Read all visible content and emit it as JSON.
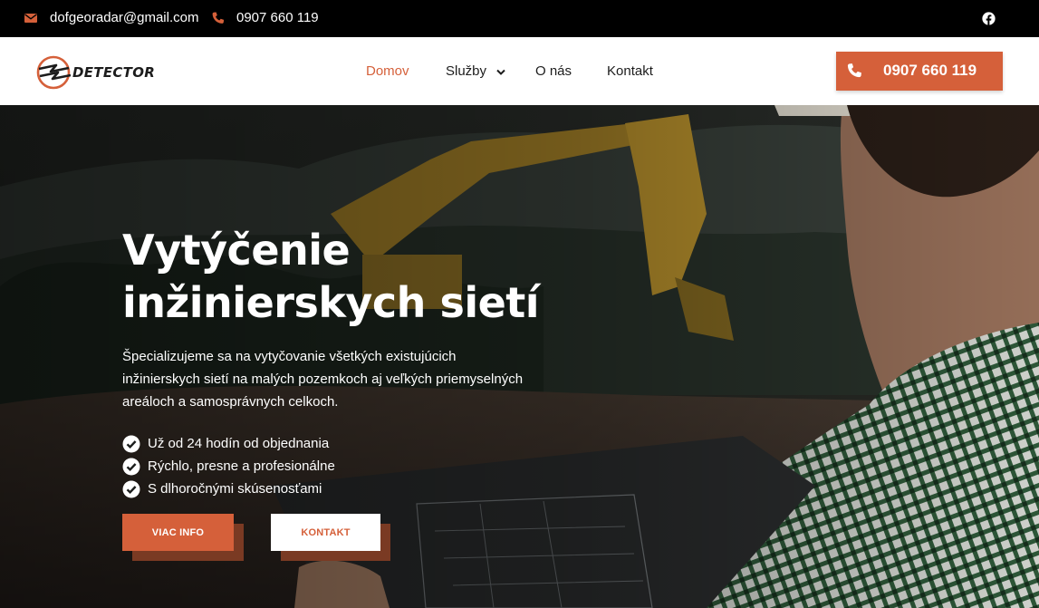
{
  "topbar": {
    "email": "dofgeoradar@gmail.com",
    "phone": "0907 660 119",
    "email_icon": "envelope-icon",
    "phone_icon": "phone-icon",
    "social_icon": "facebook-icon"
  },
  "header": {
    "logo_text": "DETECTOR",
    "nav": [
      {
        "label": "Domov",
        "active": true
      },
      {
        "label": "Služby",
        "has_dropdown": true
      },
      {
        "label": "O nás"
      },
      {
        "label": "Kontakt"
      }
    ],
    "cta_phone": "0907 660 119"
  },
  "hero": {
    "title_line1": "Vytýčenie",
    "title_line2": "inžinierskych sietí",
    "description": "Špecializujeme sa na vytyčovanie všetkých existujúcich inžinierskych sietí na malých pozemkoch aj veľkých priemyselných areáloch a samosprávnych celkoch.",
    "checks": [
      "Už od 24 hodín od objednania",
      "Rýchlo, presne a profesionálne",
      "S dlhoročnými skúsenosťami"
    ],
    "button_primary": "VIAC INFO",
    "button_secondary": "KONTAKT"
  },
  "colors": {
    "accent": "#d5603a",
    "topbar_bg": "#000000",
    "header_bg": "#ffffff",
    "text_dark": "#1c1c1c"
  }
}
